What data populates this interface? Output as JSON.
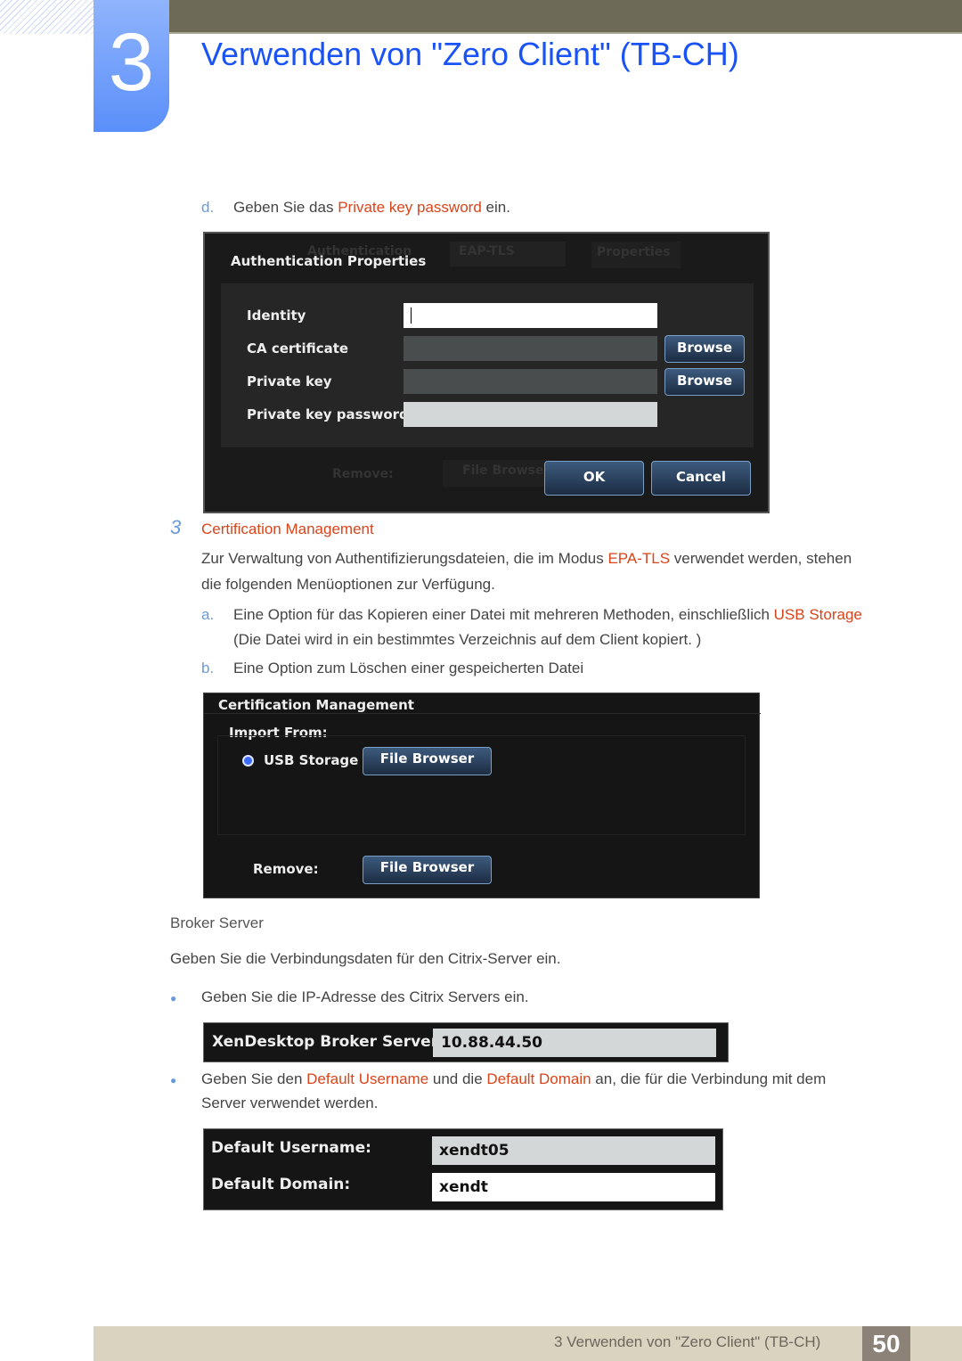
{
  "header": {
    "chapter_number": "3",
    "title": "Verwenden von \"Zero Client\" (TB-CH)"
  },
  "step_d": {
    "marker": "d.",
    "pre": "Geben Sie das ",
    "hl": "Private key password",
    "post": " ein."
  },
  "auth_dialog": {
    "title": "Authentication Properties",
    "bg_authentication": "Authentication",
    "bg_method": "EAP-TLS",
    "bg_properties": "Properties",
    "bg_remove": "Remove:",
    "bg_file_browser": "File Browse",
    "fields": [
      {
        "label": "Identity",
        "value": ""
      },
      {
        "label": "CA certificate",
        "button": "Browse"
      },
      {
        "label": "Private key",
        "button": "Browse"
      },
      {
        "label": "Private key password"
      }
    ],
    "ok": "OK",
    "cancel": "Cancel"
  },
  "section3": {
    "marker": "3",
    "heading": "Certification Management",
    "para_pre": "Zur Verwaltung von Authentifizierungsdateien, die im Modus ",
    "para_hl": "EPA-TLS",
    "para_post": " verwendet werden, stehen",
    "para_line2": "die folgenden Menüoptionen zur Verfügung.",
    "item_a": {
      "marker": "a.",
      "pre": "Eine Option für das Kopieren einer Datei mit mehreren Methoden, einschließlich ",
      "hl": "USB Storage",
      "line2": "(Die Datei wird in ein bestimmtes Verzeichnis auf dem Client kopiert. )"
    },
    "item_b": {
      "marker": "b.",
      "text": "Eine Option zum Löschen einer gespeicherten Datei"
    }
  },
  "cert_dialog": {
    "title": "Certification Management",
    "import_from": "Import From:",
    "usb_storage": "USB Storage",
    "file_browser": "File Browser",
    "remove": "Remove:",
    "colors": {
      "radio": "#3b6cff"
    }
  },
  "broker": {
    "heading": "Broker Server",
    "intro": "Geben Sie die Verbindungsdaten für den Citrix-Server ein.",
    "bullet1": "Geben Sie die IP-Adresse des Citrix Servers ein.",
    "server_label": "XenDesktop Broker Server:",
    "server_value": "10.88.44.50",
    "bullet2_pre": "Geben Sie den ",
    "bullet2_hl1": "Default Username",
    "bullet2_mid": " und die ",
    "bullet2_hl2": "Default Domain",
    "bullet2_post": " an, die für die Verbindung mit dem",
    "bullet2_line2": "Server verwendet werden.",
    "username_label": "Default Username:",
    "username_value": "xendt05",
    "domain_label": "Default Domain:",
    "domain_value": "xendt"
  },
  "footer": {
    "text": "3 Verwenden von \"Zero Client\" (TB-CH)",
    "page": "50"
  },
  "colors": {
    "accent": "#d9441a",
    "title": "#1a53f5",
    "marker": "#6a9bd8",
    "topbar": "#6d6b58",
    "footer": "#d9d3c0"
  }
}
